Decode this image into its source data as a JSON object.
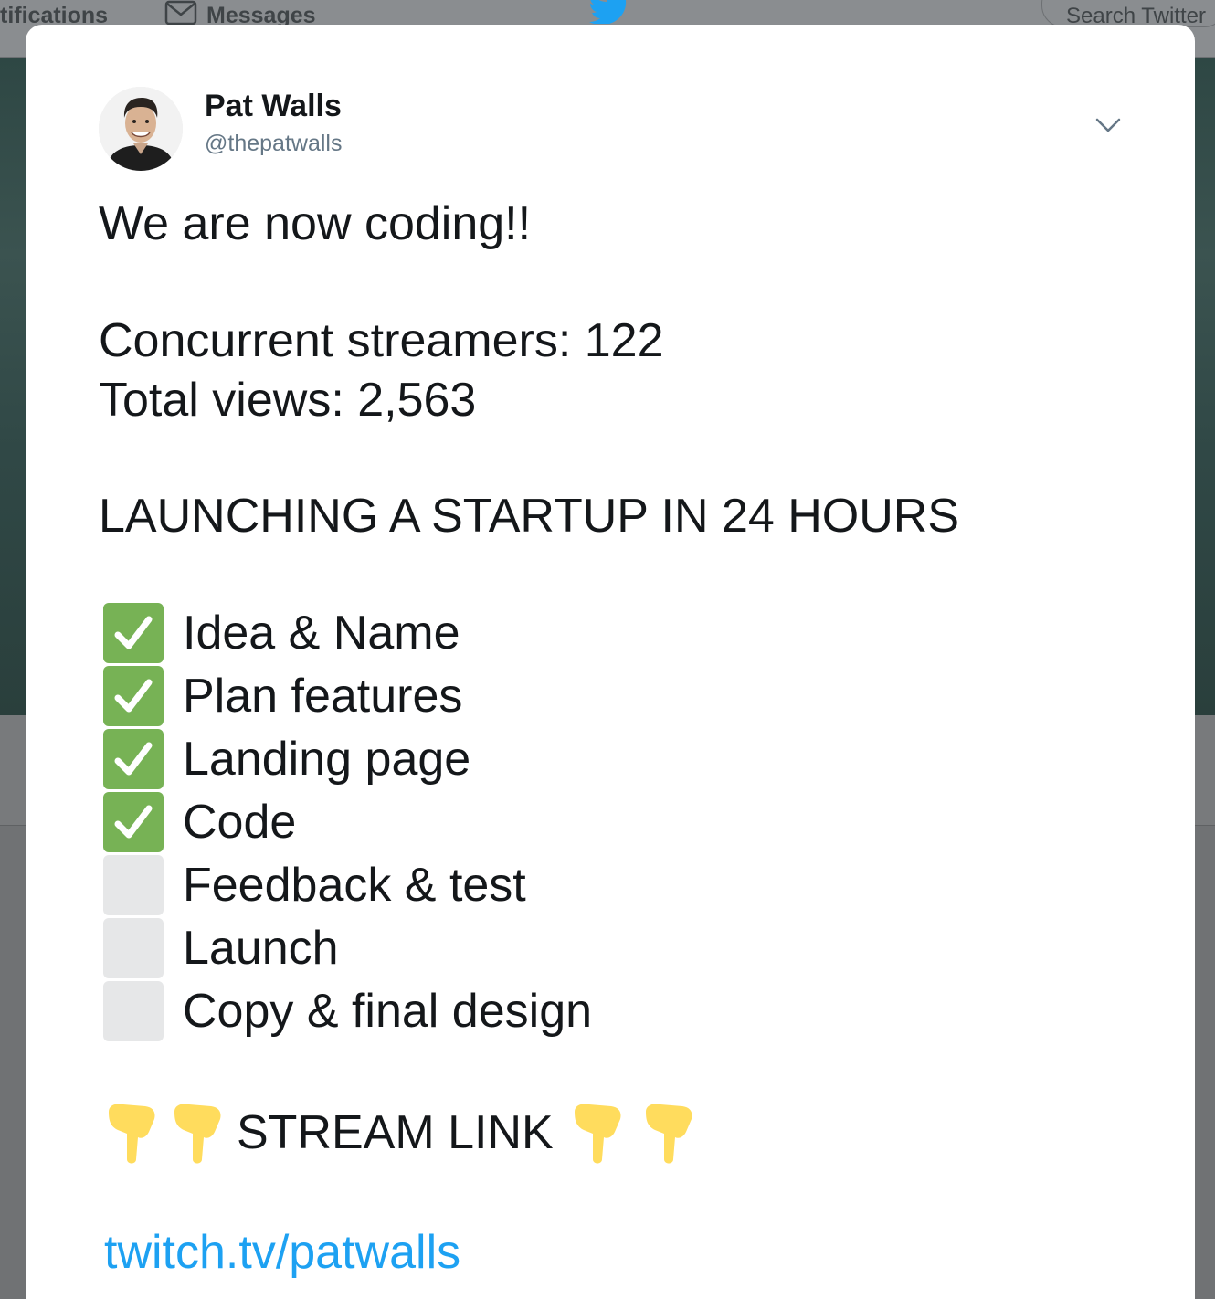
{
  "nav": {
    "notifications_label": "tifications",
    "messages_label": "Messages",
    "search_placeholder": "Search Twitter"
  },
  "tweet": {
    "author": {
      "name": "Pat Walls",
      "handle": "@thepatwalls"
    },
    "lines": {
      "intro": "We are now coding!!",
      "streamers": "Concurrent streamers: 122",
      "views": "Total views: 2,563",
      "headline": "LAUNCHING A STARTUP IN 24 HOURS"
    },
    "checklist": [
      {
        "label": "Idea & Name",
        "done": true
      },
      {
        "label": "Plan features",
        "done": true
      },
      {
        "label": "Landing page",
        "done": true
      },
      {
        "label": "Code",
        "done": true
      },
      {
        "label": "Feedback & test",
        "done": false
      },
      {
        "label": "Launch",
        "done": false
      },
      {
        "label": "Copy & final design",
        "done": false
      }
    ],
    "stream_label": "STREAM LINK",
    "link": "twitch.tv/patwalls"
  },
  "colors": {
    "accent": "#1da1f2",
    "check_green": "#77b255",
    "unchecked_grey": "#e6e7e8",
    "handle_grey": "#657786",
    "emoji_yellow": "#ffdc5d"
  }
}
